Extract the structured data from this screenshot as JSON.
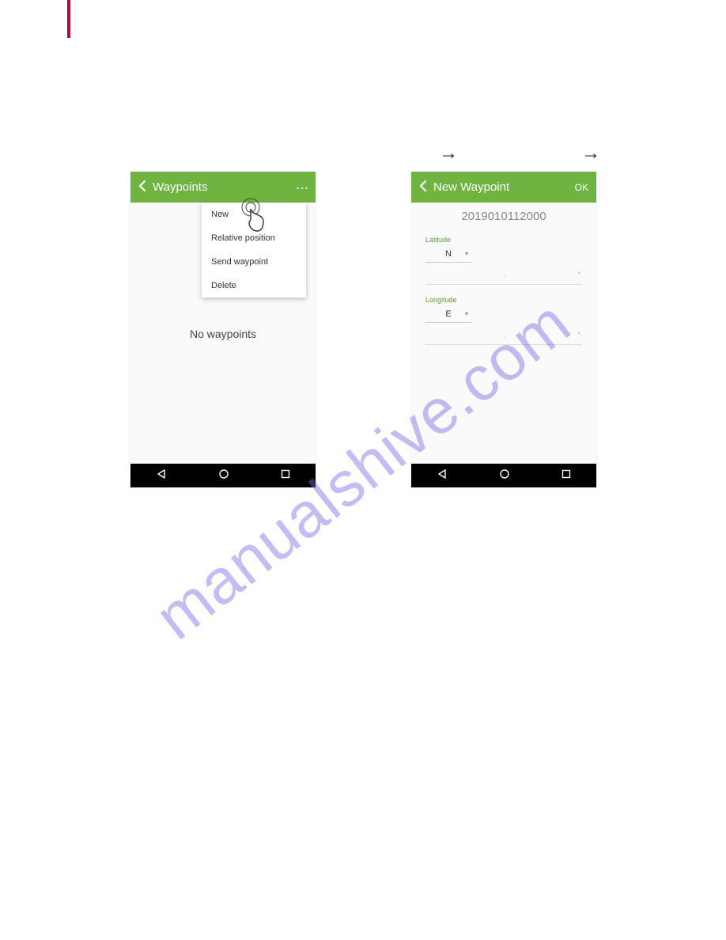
{
  "watermark": "manualshive.com",
  "arrows": {
    "a1": "→",
    "a2": "→"
  },
  "phone1": {
    "header": {
      "title": "Waypoints"
    },
    "menu": {
      "new": "New",
      "relative": "Relative position",
      "send": "Send waypoint",
      "delete": "Delete"
    },
    "empty": "No waypoints"
  },
  "phone2": {
    "header": {
      "title": "New Waypoint",
      "ok": "OK"
    },
    "waypoint_name": "2019010112000",
    "latitude": {
      "label": "Latitude",
      "dir": "N"
    },
    "longitude": {
      "label": "Longitude",
      "dir": "E"
    }
  },
  "coord_marks": {
    "m1": ".",
    "m2": "°"
  }
}
